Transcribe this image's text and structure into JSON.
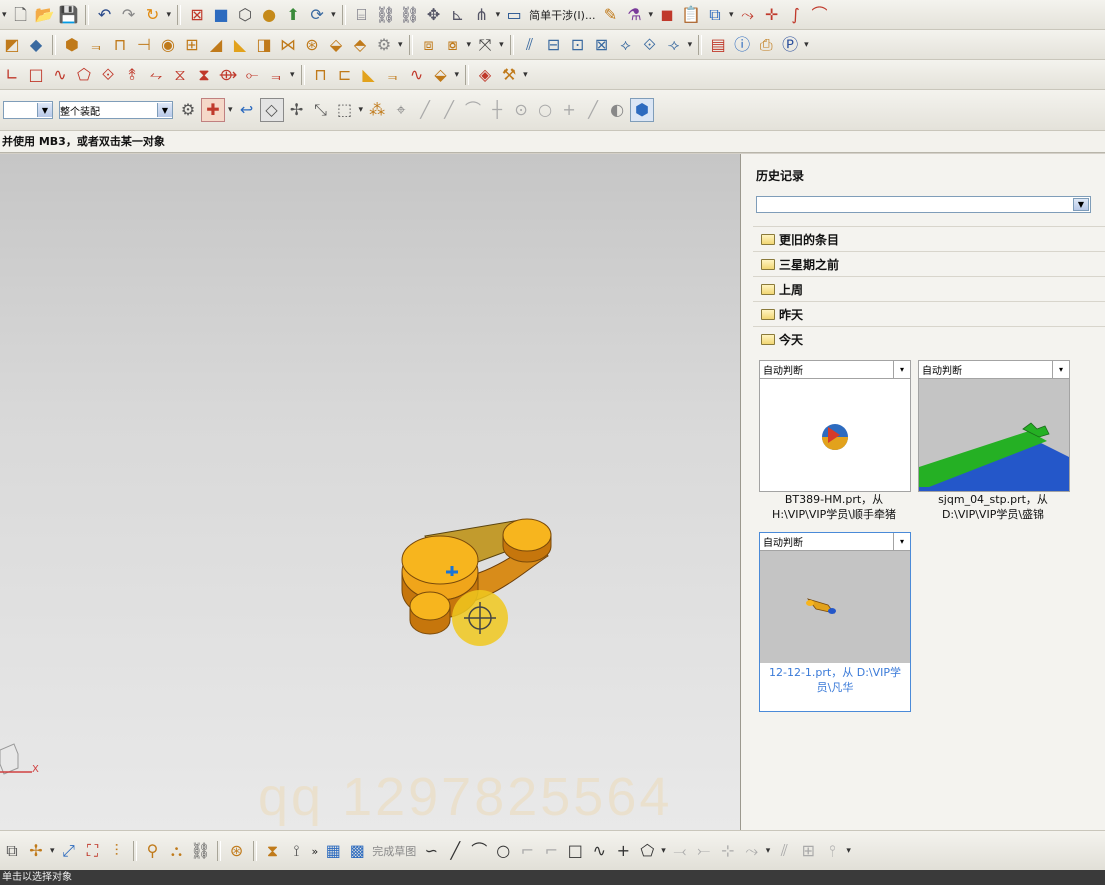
{
  "toolbar": {
    "simple_interference": "简单干涉(I)...",
    "assembly_filter": "整个装配"
  },
  "cue_line": "并使用 MB3，或者双击某一对象",
  "history": {
    "title": "历史记录",
    "groups": [
      "更旧的条目",
      "三星期之前",
      "上周",
      "昨天",
      "今天"
    ],
    "cards": [
      {
        "mode": "自动判断",
        "file": "BT389-HM.prt，从",
        "path": "H:\\VIP\\VIP学员\\顺手牵猪"
      },
      {
        "mode": "自动判断",
        "file": "sjqm_04_stp.prt，从",
        "path": "D:\\VIP\\VIP学员\\盛锦"
      },
      {
        "mode": "自动判断",
        "file": "12-12-1.prt，从 D:\\VIP学",
        "path": "员\\凡华"
      }
    ]
  },
  "viewport": {
    "watermark": "qq 1297825564",
    "axis_label": "X"
  },
  "bottom_toolbar": {
    "finish_sketch": "完成草图"
  },
  "status_bar": "单击以选择对象"
}
